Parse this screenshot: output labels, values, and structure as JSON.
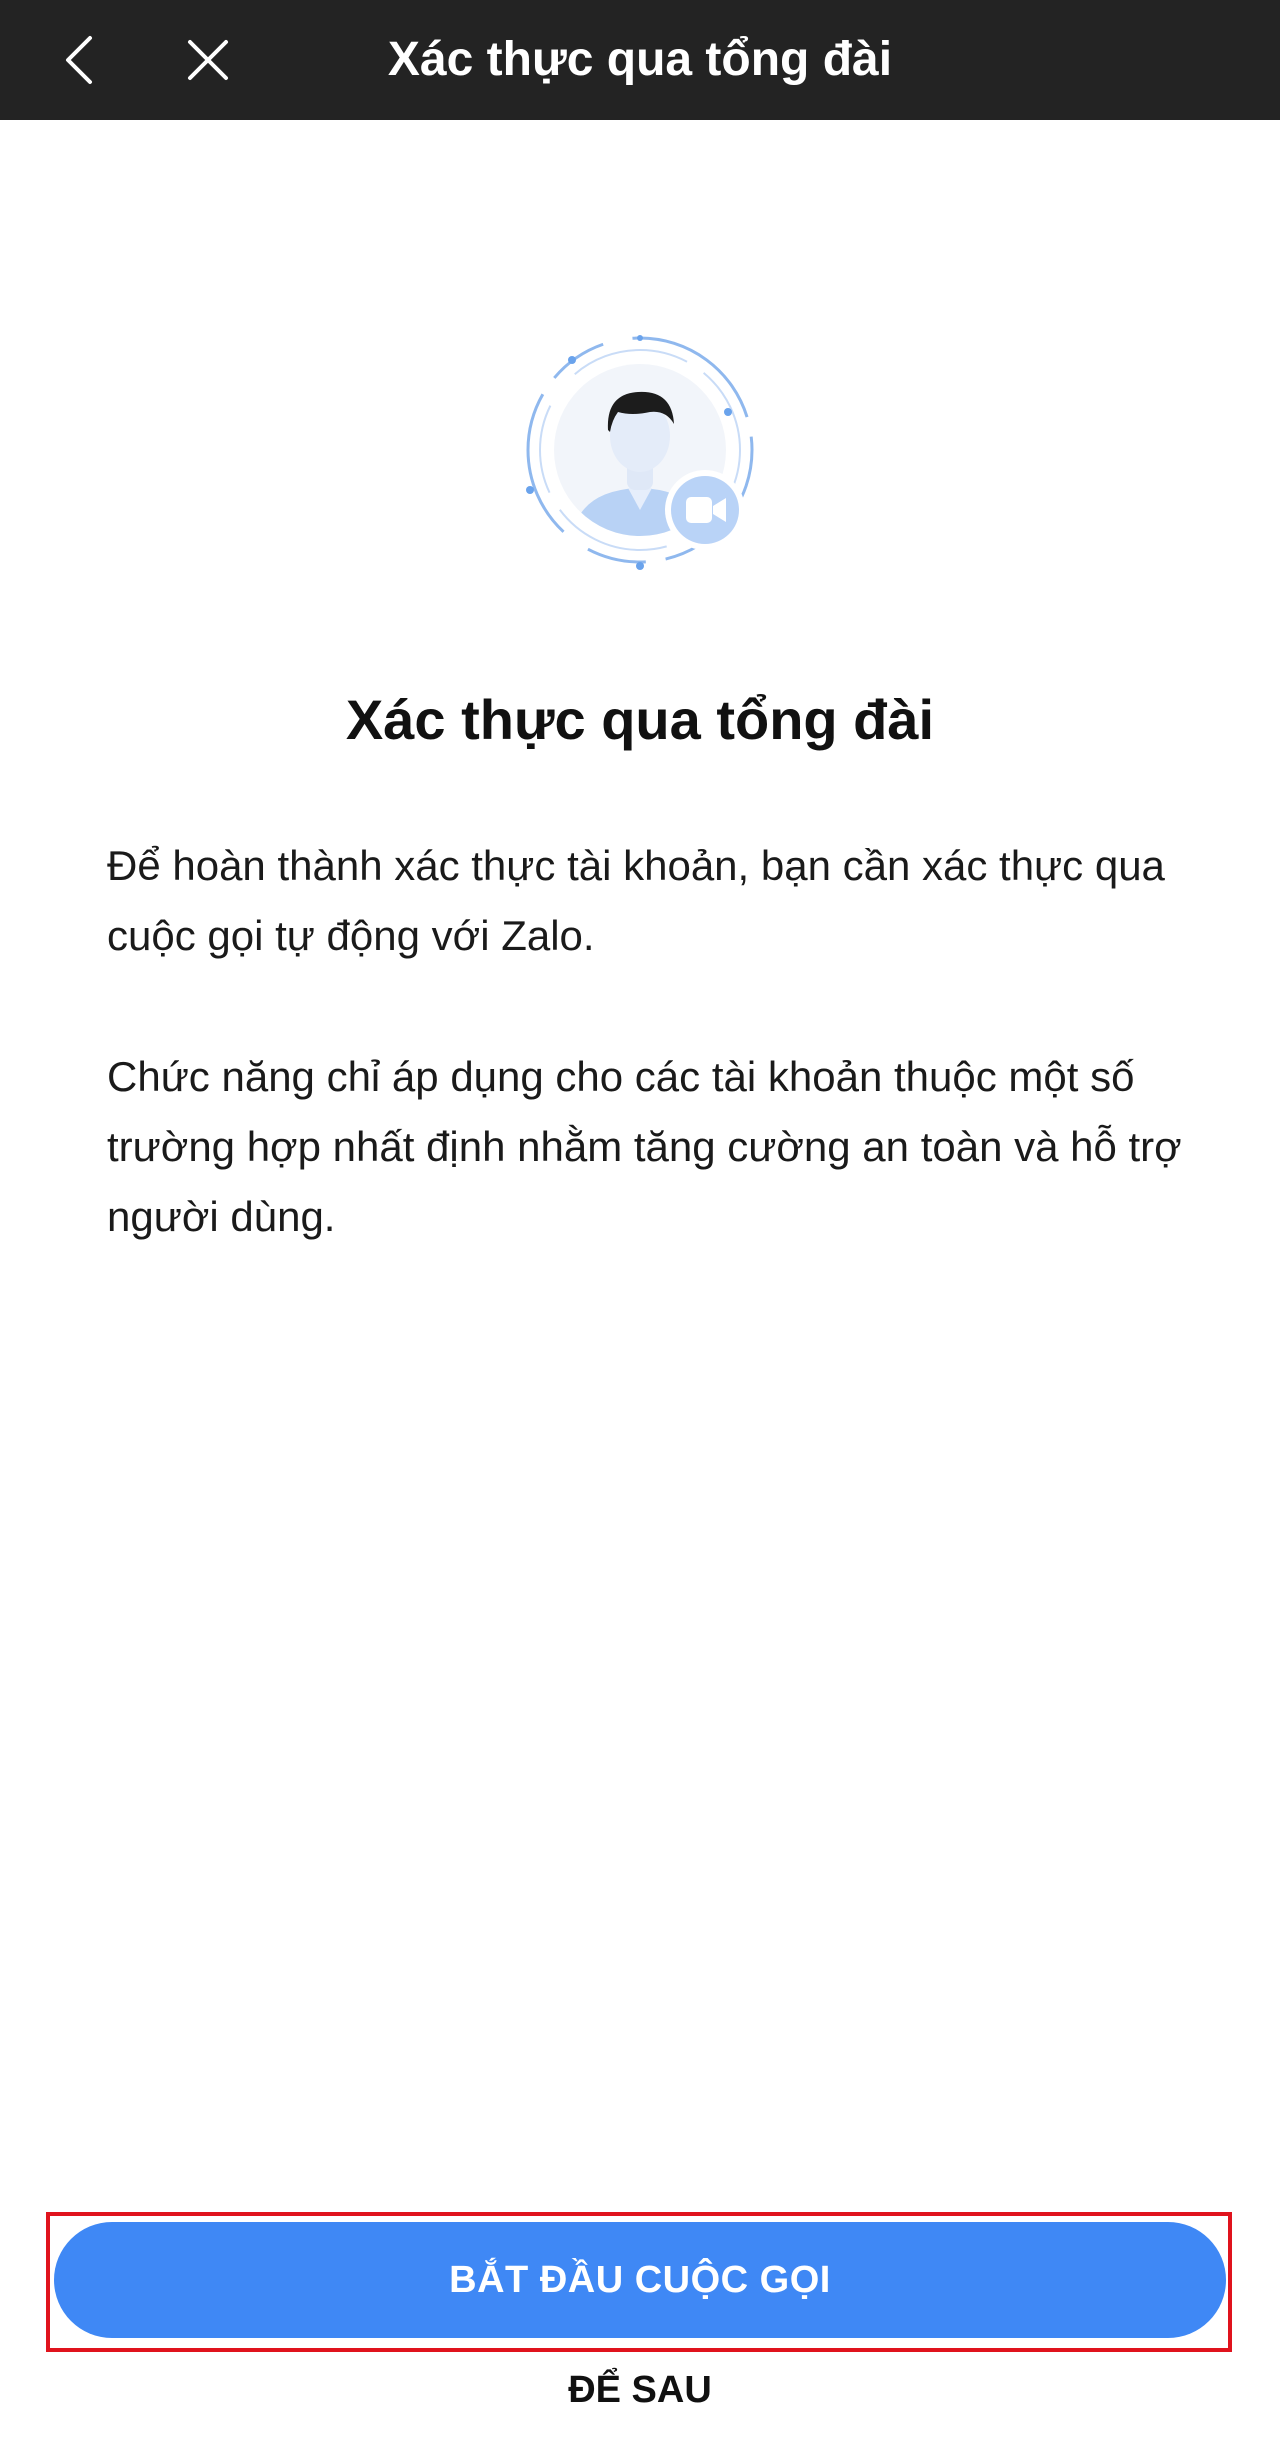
{
  "header": {
    "title": "Xác thực qua tổng đài",
    "back_icon": "chevron-left-icon",
    "close_icon": "close-icon"
  },
  "illustration": {
    "icon": "agent-with-video-camera-icon"
  },
  "main": {
    "heading": "Xác thực qua tổng đài",
    "paragraph_1": "Để hoàn thành xác thực tài khoản, bạn cần xác thực qua cuộc gọi tự động với Zalo.",
    "paragraph_2": "Chức năng chỉ áp dụng cho các tài khoản thuộc một số trường hợp nhất định nhằm tăng cường an toàn và hỗ trợ người dùng."
  },
  "actions": {
    "start_call_label": "BẮT ĐẦU CUỘC GỌI",
    "later_label": "ĐỂ SAU"
  },
  "colors": {
    "header_bg": "#232323",
    "primary": "#3f88f5",
    "highlight": "#e0131d"
  }
}
